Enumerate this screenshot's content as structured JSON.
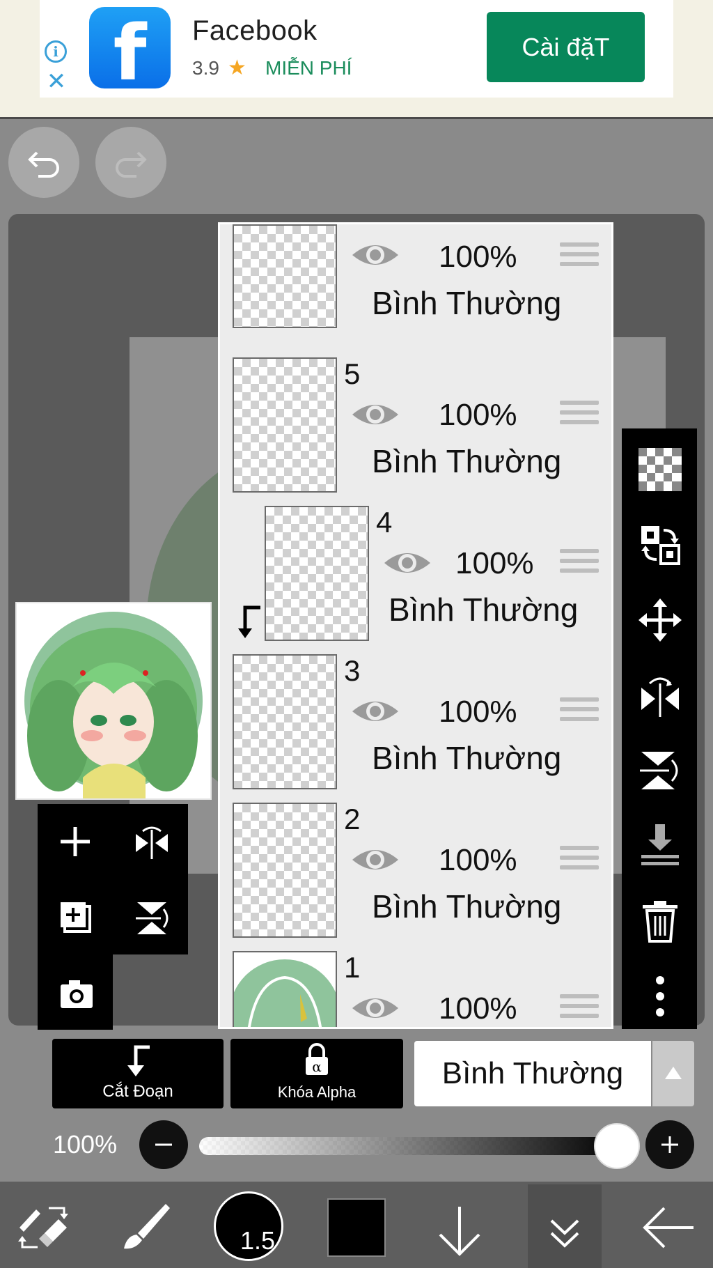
{
  "ad": {
    "app_name": "Facebook",
    "rating": "3.9",
    "star": "★",
    "price": "MIỄN PHÍ",
    "install_label": "Cài đặT",
    "info_glyph": "i",
    "close_glyph": "✕",
    "logo_glyph": "f"
  },
  "colors": {
    "ad_install": "#07875a",
    "ad_free": "#1a8c5b",
    "toolbar_bg": "#000000",
    "panel_bg": "#ececec",
    "app_bg": "#8a8a8a"
  },
  "layers": [
    {
      "number": "",
      "opacity": "100%",
      "blend": "Bình Thường",
      "clipped": false
    },
    {
      "number": "5",
      "opacity": "100%",
      "blend": "Bình Thường",
      "clipped": false
    },
    {
      "number": "4",
      "opacity": "100%",
      "blend": "Bình Thường",
      "clipped": true
    },
    {
      "number": "3",
      "opacity": "100%",
      "blend": "Bình Thường",
      "clipped": false
    },
    {
      "number": "2",
      "opacity": "100%",
      "blend": "Bình Thường",
      "clipped": false
    },
    {
      "number": "1",
      "opacity": "100%",
      "blend": "",
      "clipped": false
    }
  ],
  "left_tools": [
    "add-layer-icon",
    "flip-horizontal-icon",
    "add-copy-icon",
    "flip-vertical-icon",
    "camera-icon"
  ],
  "right_tools": [
    "transparency-icon",
    "swap-layer-icon",
    "move-icon",
    "flip-horizontal-icon",
    "flip-vertical-icon",
    "merge-down-icon",
    "trash-icon",
    "more-icon"
  ],
  "controls": {
    "clip_label": "Cắt Đoạn",
    "alpha_label": "Khóa Alpha",
    "blend_mode": "Bình Thường",
    "opacity": "100%",
    "opacity_value": 1.0
  },
  "bottom_nav": {
    "brush_size": "1.5",
    "current_color": "#000000",
    "items": [
      "tool-switch-icon",
      "brush-icon",
      "brush-size",
      "color-swatch",
      "down-arrow-icon",
      "collapse-icon",
      "back-arrow-icon"
    ]
  }
}
